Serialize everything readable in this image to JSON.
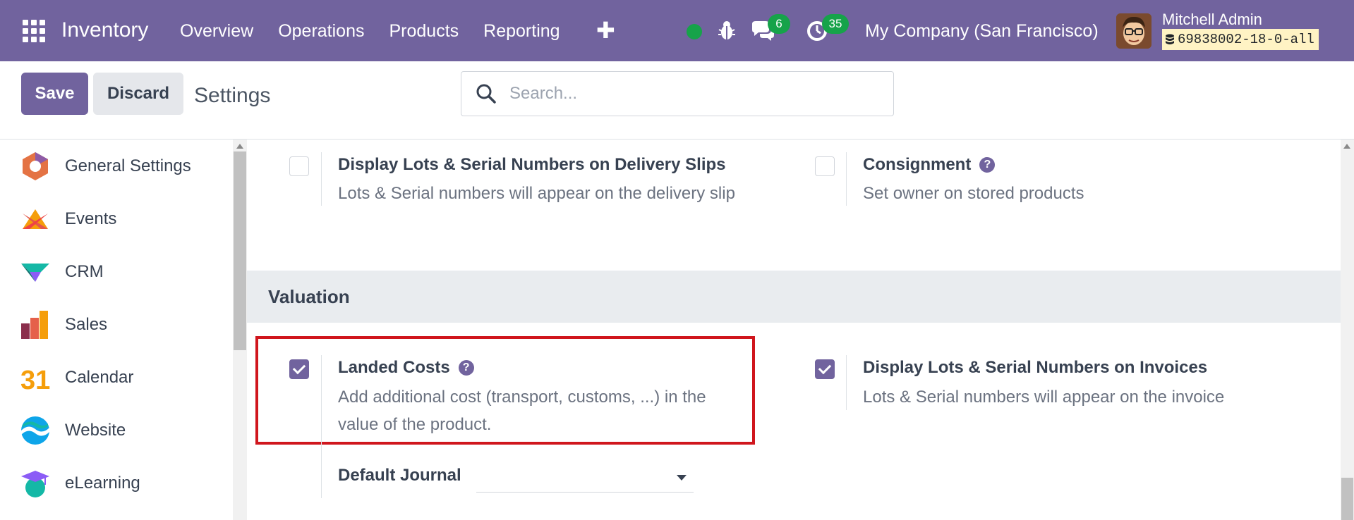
{
  "navbar": {
    "app_name": "Inventory",
    "menu": [
      "Overview",
      "Operations",
      "Products",
      "Reporting"
    ],
    "plus": "✚",
    "message_count": "6",
    "activity_count": "35",
    "company": "My Company (San Francisco)",
    "user_name": "Mitchell Admin",
    "db_name": "69838002-18-0-all",
    "accent_color": "#71639e"
  },
  "control": {
    "save_label": "Save",
    "discard_label": "Discard",
    "breadcrumb": "Settings",
    "search_placeholder": "Search..."
  },
  "sidebar": {
    "items": [
      {
        "label": "General Settings",
        "icon": "general-settings-icon"
      },
      {
        "label": "Events",
        "icon": "events-icon"
      },
      {
        "label": "CRM",
        "icon": "crm-icon"
      },
      {
        "label": "Sales",
        "icon": "sales-icon"
      },
      {
        "label": "Calendar",
        "icon": "calendar-icon",
        "icon_text": "31"
      },
      {
        "label": "Website",
        "icon": "website-icon"
      },
      {
        "label": "eLearning",
        "icon": "elearning-icon"
      }
    ]
  },
  "settings": {
    "top_left": {
      "title": "Display Lots & Serial Numbers on Delivery Slips",
      "description": "Lots & Serial numbers will appear on the delivery slip",
      "checked": false
    },
    "top_right": {
      "title": "Consignment",
      "description": "Set owner on stored products",
      "checked": false
    },
    "section_title": "Valuation",
    "landed_costs": {
      "title": "Landed Costs",
      "description_line1": "Add additional cost (transport, customs, ...) in the",
      "description_line2": "value of the product.",
      "checked": true
    },
    "lots_invoices": {
      "title": "Display Lots & Serial Numbers on Invoices",
      "description": "Lots & Serial numbers will appear on the invoice",
      "checked": true
    },
    "default_journal_label": "Default Journal",
    "default_journal_value": "",
    "help_glyph": "?"
  }
}
